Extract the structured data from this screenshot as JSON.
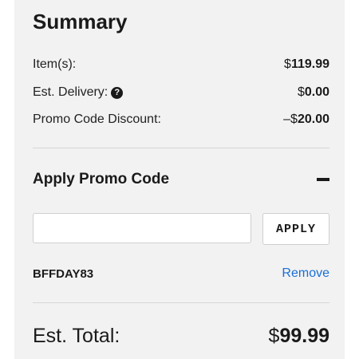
{
  "summary": {
    "title": "Summary",
    "items_label": "Item(s):",
    "items_currency": "$",
    "items_amount": "119.99",
    "delivery_label": "Est. Delivery:",
    "delivery_icon": "question-circle-icon",
    "delivery_currency": "$",
    "delivery_amount": "0.00",
    "promo_discount_label": "Promo Code Discount:",
    "promo_discount_prefix": "–$",
    "promo_discount_amount": "20.00"
  },
  "promo": {
    "heading": "Apply Promo Code",
    "collapse_icon": "minus-icon",
    "input_value": "",
    "input_placeholder": "",
    "apply_label": "APPLY",
    "applied_code": "BFFDAY83",
    "remove_label": "Remove"
  },
  "total": {
    "label": "Est. Total:",
    "currency": "$",
    "amount": "99.99"
  },
  "colors": {
    "panel_background": "#f2f2f2",
    "link": "#1a6fd6",
    "text": "#1a1a1a"
  }
}
